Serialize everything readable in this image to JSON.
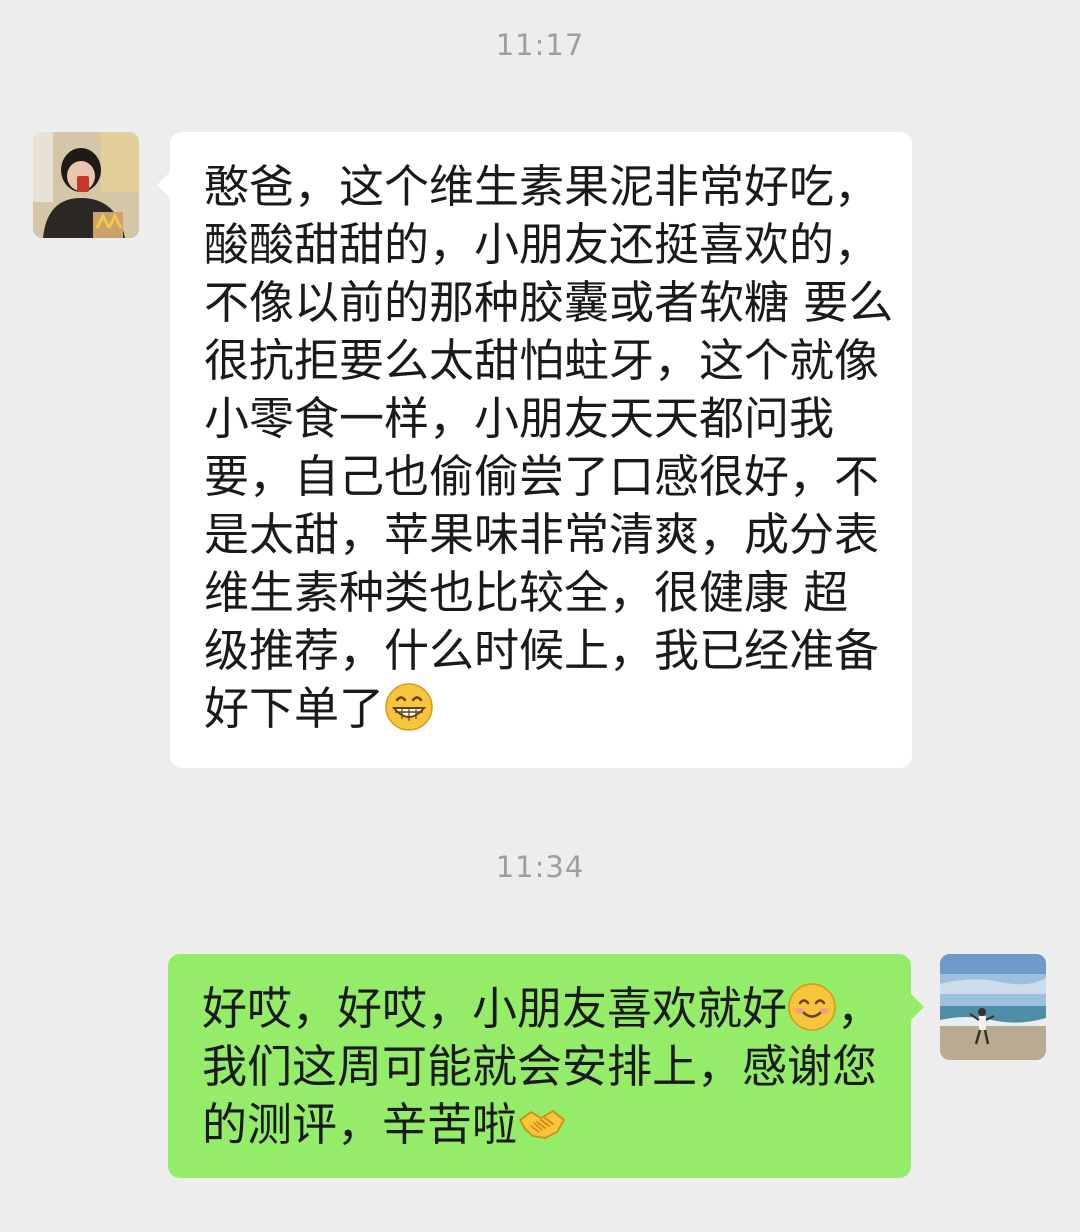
{
  "timestamps": [
    "11:17",
    "11:34"
  ],
  "messages": [
    {
      "sender": "other",
      "avatar_icon": "contact-avatar-photo",
      "lines": [
        "憨爸，这个维生素果泥非常好吃，",
        "酸酸甜甜的，小朋友还挺喜欢的，",
        "不像以前的那种胶囊或者软糖 要么",
        "很抗拒要么太甜怕蛀牙，这个就像",
        "小零食一样，小朋友天天都问我",
        "要，自己也偷偷尝了口感很好，不",
        "是太甜，苹果味非常清爽，成分表",
        "维生素种类也比较全，很健康  超",
        "级推荐，什么时候上，我已经准备",
        "好下单了"
      ],
      "trailing_emoji": "grinning-face-emoji"
    },
    {
      "sender": "self",
      "avatar_icon": "self-avatar-beach-photo",
      "lines": [
        "好哎，好哎，小朋友喜欢就好",
        "，",
        "我们这周可能就会安排上，感谢您",
        "的测评，辛苦啦"
      ],
      "inline_emoji": "smiling-face-emoji",
      "trailing_emoji": "handshake-emoji"
    }
  ],
  "colors": {
    "background": "#ededed",
    "incoming_bubble": "#ffffff",
    "outgoing_bubble": "#95ec69",
    "timestamp_text": "#9e9e9e"
  }
}
